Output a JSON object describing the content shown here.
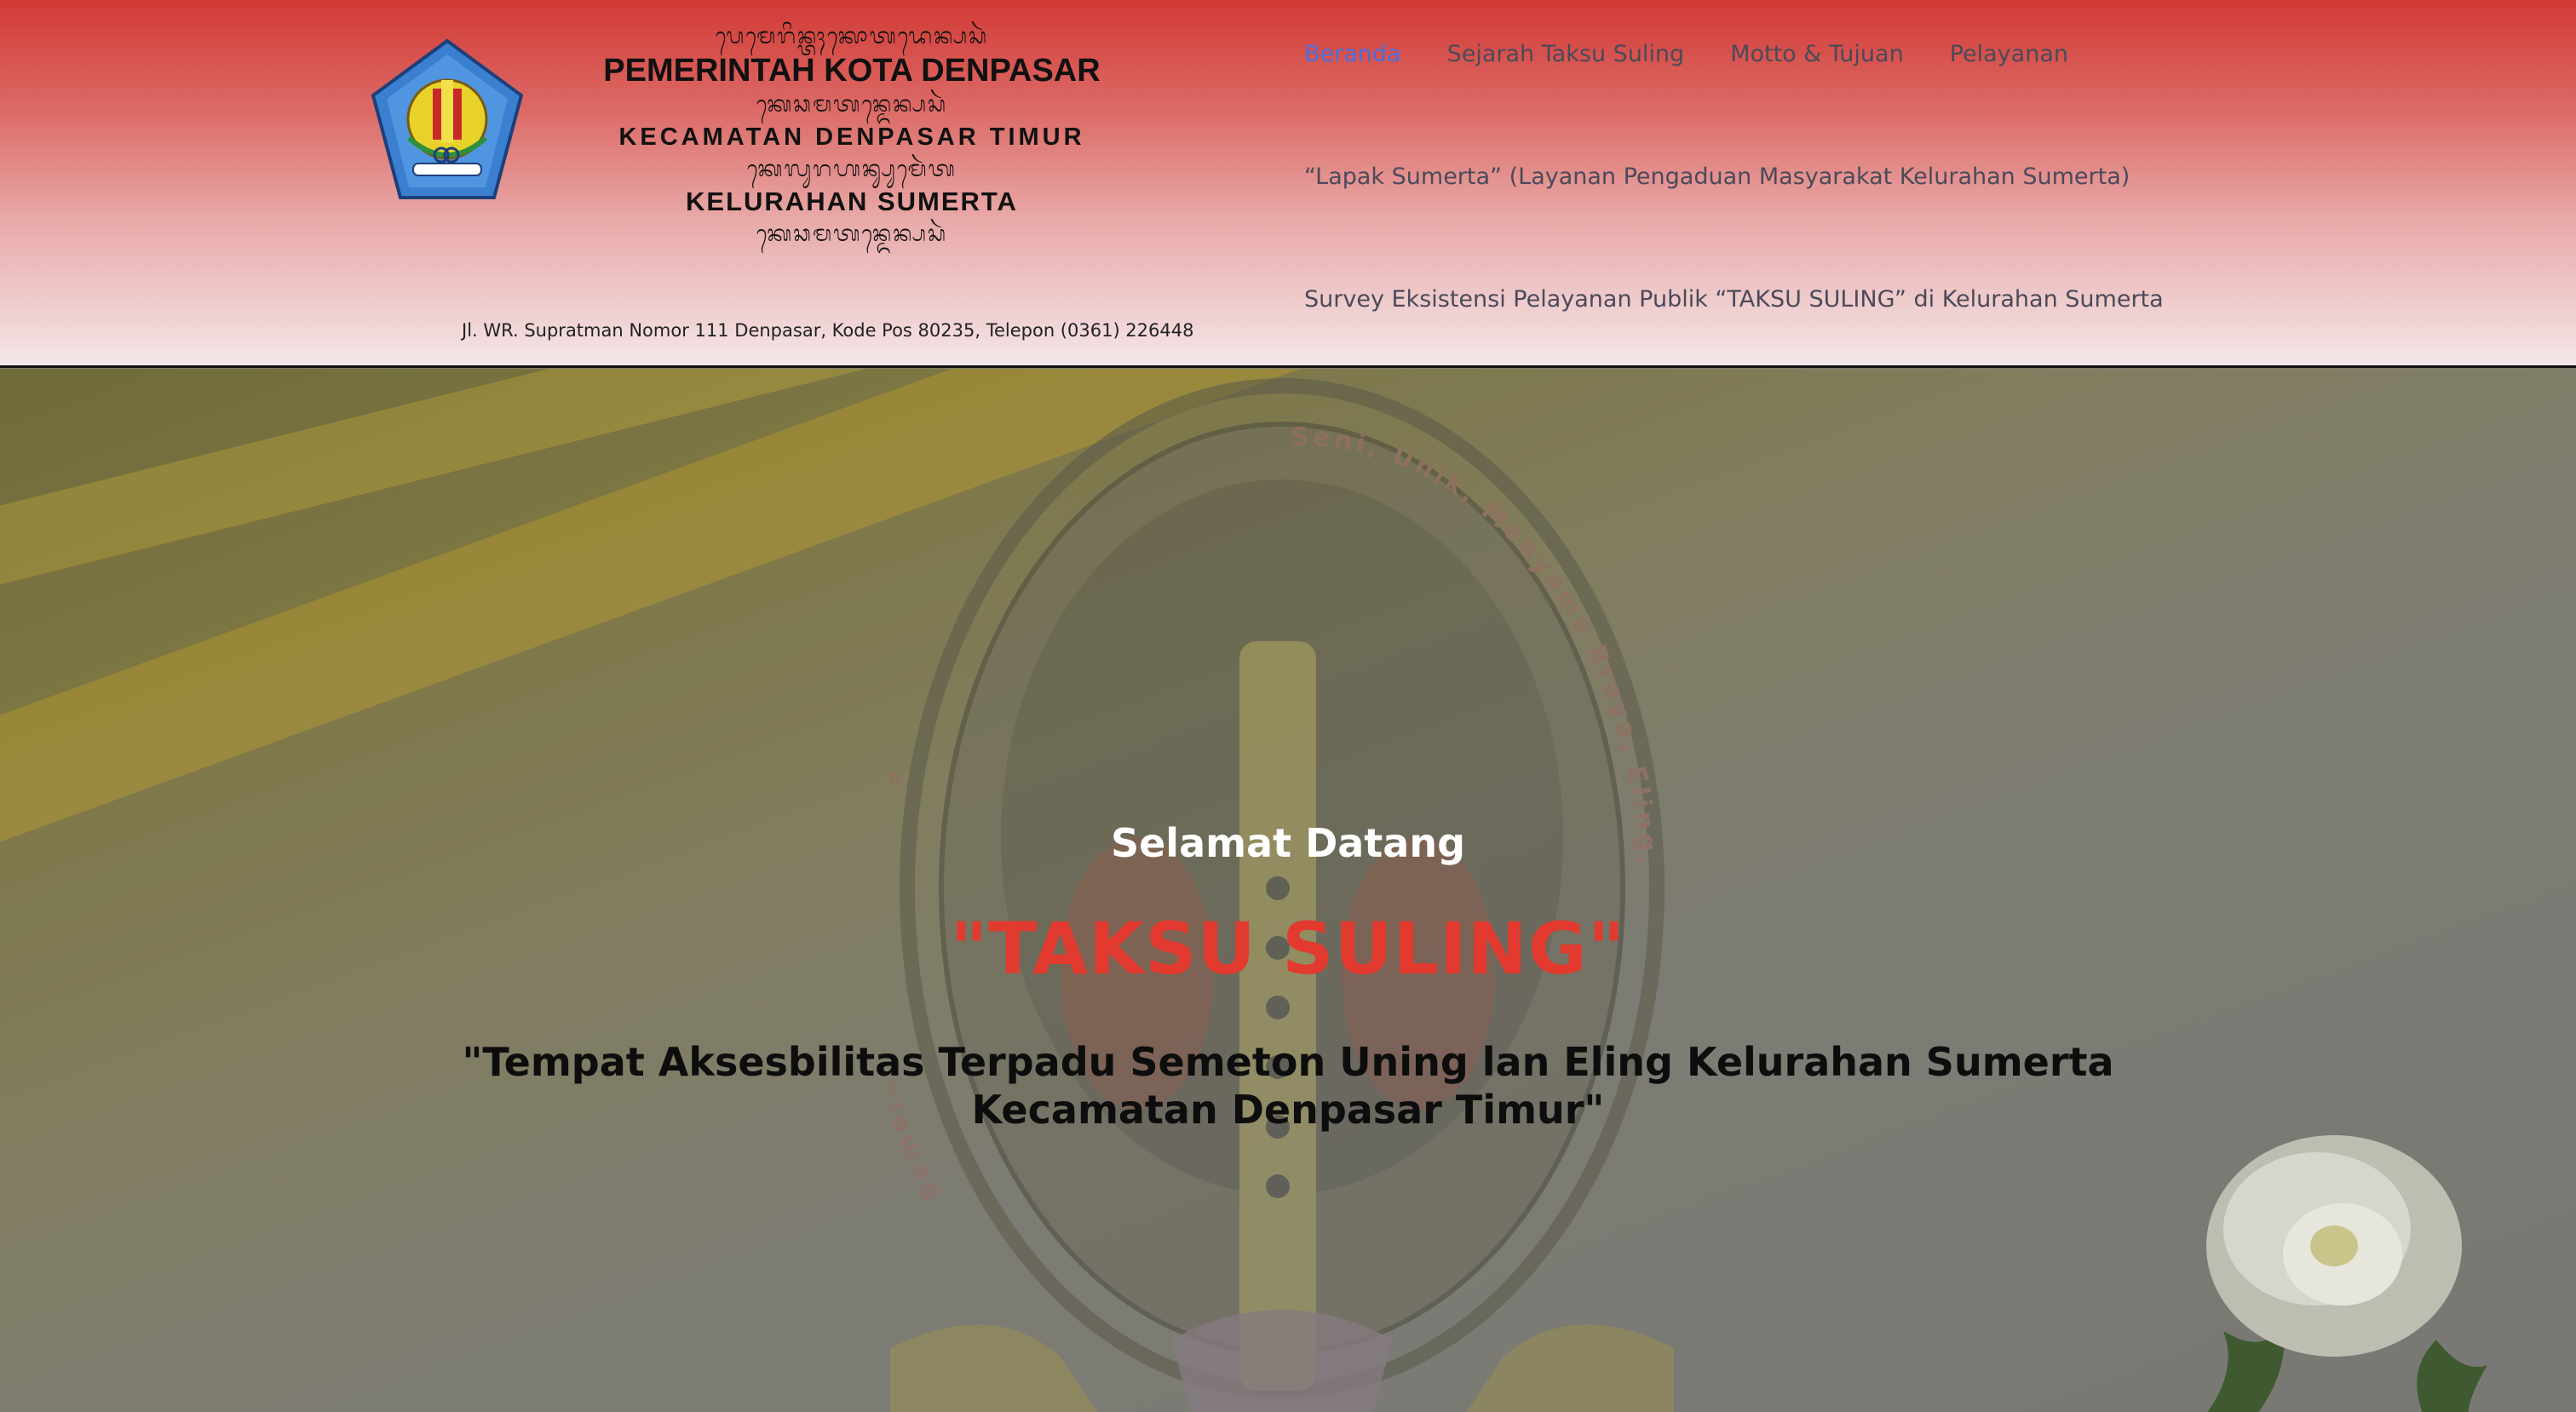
{
  "header": {
    "kop": {
      "script_1": "ᬧᬾᬫᬾᬭᬶᬦ᭄ᬢᬄᬓᭀᬢᬤᬾᬦ᭄ᬧᬲᬃ",
      "line_1": "PEMERINTAH KOTA DENPASAR",
      "script_2": "ᬓᬾᬘᬫᬢᬦ᭄ᬤᬾᬦ᭄ᬧᬲᬃ",
      "line_2": "KECAMATAN DENPASAR TIMUR",
      "script_3": "ᬓᬾᬮᬸᬭᬳᬦ᭄ᬲᬸᬫᬾᬃᬢ",
      "line_3": "KELURAHAN SUMERTA",
      "script_4": "ᬓᬾᬘᬫᬢᬦ᭄ᬤᬾᬦ᭄ᬧᬲᬃ"
    },
    "address": "Jl. WR. Supratman Nomor 111 Denpasar, Kode Pos 80235, Telepon (0361) 226448"
  },
  "nav": {
    "items": [
      {
        "label": "Beranda",
        "active": true
      },
      {
        "label": "Sejarah Taksu Suling"
      },
      {
        "label": "Motto & Tujuan"
      },
      {
        "label": "Pelayanan"
      },
      {
        "label": "“Lapak Sumerta” (Layanan Pengaduan Masyarakat Kelurahan Sumerta)"
      },
      {
        "label": "Survey Eksistensi Pelayanan Publik “TAKSU SULING” di Kelurahan Sumerta"
      }
    ]
  },
  "hero": {
    "welcome": "Selamat Datang",
    "brand": "\"TAKSU SULING\"",
    "tagline_1": "\"Tempat Aksesbilitas Terpadu Semeton Uning lan Eling Kelurahan Sumerta",
    "tagline_2": "Kecamatan Denpasar Timur\"",
    "emblem_ring_text": "Seni, Unik, Menyama Braya, Eling, Ramah",
    "emblem_ring_text_left": "Semeton Uning Lan Eling"
  },
  "colors": {
    "header_top": "#d23a35",
    "nav_active": "#4a6fe0",
    "brand_red": "#e23a2e"
  }
}
